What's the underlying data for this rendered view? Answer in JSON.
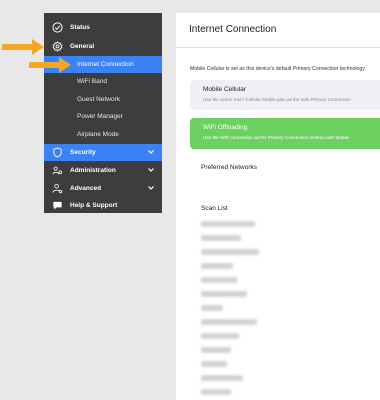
{
  "sidebar": {
    "items": [
      {
        "label": "Status",
        "icon": "check-circle-icon"
      },
      {
        "label": "General",
        "icon": "gear-icon"
      },
      {
        "label": "Internet Connection"
      },
      {
        "label": "WiFi Band"
      },
      {
        "label": "Guest Network"
      },
      {
        "label": "Power Manager"
      },
      {
        "label": "Airplane Mode"
      },
      {
        "label": "Security",
        "icon": "shield-icon"
      },
      {
        "label": "Administration",
        "icon": "users-gear-icon"
      },
      {
        "label": "Advanced",
        "icon": "person-gear-icon"
      },
      {
        "label": "Help & Support",
        "icon": "chat-bubble-icon"
      }
    ]
  },
  "content": {
    "title": "Internet Connection",
    "notice": "Mobile Cellular is set as this device's default Primary Connection technology",
    "cellular": {
      "title": "Mobile Cellular",
      "desc": "Use the active SIM / Cellular Mobile plan as the sole Primary Connection"
    },
    "wifi": {
      "title": "WiFi Offloading",
      "desc": "Use the WiFi connection as the Primary Connection method with Mobile"
    },
    "preferred_label": "Preferred Networks",
    "scan_label": "Scan List"
  },
  "colors": {
    "sidebar_bg": "#3d3d3d",
    "accent_blue": "#3b82f6",
    "wifi_green": "#6cd160",
    "arrow_orange": "#f5a623"
  }
}
